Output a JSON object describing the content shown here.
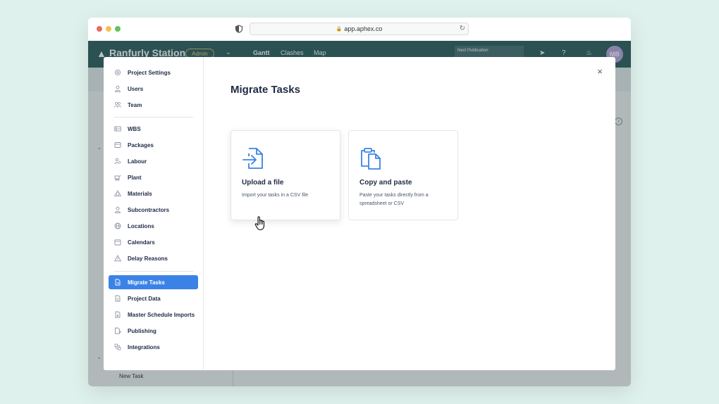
{
  "browser": {
    "url": "app.aphex.co"
  },
  "app": {
    "project_name": "Ranfurly Station",
    "role_badge": "Admin",
    "nav_tabs": [
      "Gantt",
      "Clashes",
      "Map"
    ],
    "next_publication": "Next Publication:",
    "avatar_initials": "MB",
    "new_task": "New Task"
  },
  "modal": {
    "title": "Migrate Tasks",
    "close_label": "×",
    "menu": [
      {
        "label": "Project Settings",
        "icon": "gear-icon"
      },
      {
        "label": "Users",
        "icon": "user-icon"
      },
      {
        "label": "Team",
        "icon": "team-icon"
      },
      {
        "label": "WBS",
        "icon": "wbs-icon"
      },
      {
        "label": "Packages",
        "icon": "package-icon"
      },
      {
        "label": "Labour",
        "icon": "labour-icon"
      },
      {
        "label": "Plant",
        "icon": "plant-icon"
      },
      {
        "label": "Materials",
        "icon": "materials-icon"
      },
      {
        "label": "Subcontractors",
        "icon": "subcontractor-icon"
      },
      {
        "label": "Locations",
        "icon": "globe-icon"
      },
      {
        "label": "Calendars",
        "icon": "calendar-icon"
      },
      {
        "label": "Delay Reasons",
        "icon": "warning-icon"
      },
      {
        "label": "Migrate Tasks",
        "icon": "migrate-icon",
        "active": true
      },
      {
        "label": "Project Data",
        "icon": "data-icon"
      },
      {
        "label": "Master Schedule Imports",
        "icon": "import-icon"
      },
      {
        "label": "Publishing",
        "icon": "publish-icon"
      },
      {
        "label": "Integrations",
        "icon": "integrations-icon"
      }
    ],
    "options": [
      {
        "title": "Upload a file",
        "description": "Import your tasks in a CSV file",
        "icon": "file-upload-icon"
      },
      {
        "title": "Copy and paste",
        "description": "Paste your tasks directly from a spreadsheet or CSV",
        "icon": "clipboard-icon"
      }
    ]
  },
  "colors": {
    "accent": "#3b82e6",
    "text_dark": "#1f2a44",
    "background": "#dff1ec"
  }
}
